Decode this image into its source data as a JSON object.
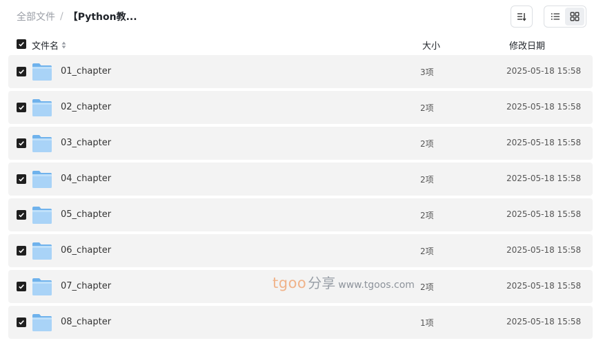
{
  "breadcrumb": {
    "root": "全部文件",
    "separator": "/",
    "current": "【Python教..."
  },
  "toolbar": {
    "sort_icon": "sort-list-icon",
    "list_view_icon": "list-view-icon",
    "grid_view_icon": "grid-view-icon",
    "active_view": "grid"
  },
  "table": {
    "headers": {
      "name": "文件名",
      "size": "大小",
      "date": "修改日期"
    },
    "select_all_checked": true,
    "rows": [
      {
        "name": "01_chapter",
        "size": "3项",
        "date": "2025-05-18 15:58",
        "checked": true
      },
      {
        "name": "02_chapter",
        "size": "2项",
        "date": "2025-05-18 15:58",
        "checked": true
      },
      {
        "name": "03_chapter",
        "size": "2项",
        "date": "2025-05-18 15:58",
        "checked": true
      },
      {
        "name": "04_chapter",
        "size": "2项",
        "date": "2025-05-18 15:58",
        "checked": true
      },
      {
        "name": "05_chapter",
        "size": "2项",
        "date": "2025-05-18 15:58",
        "checked": true
      },
      {
        "name": "06_chapter",
        "size": "2项",
        "date": "2025-05-18 15:58",
        "checked": true
      },
      {
        "name": "07_chapter",
        "size": "2项",
        "date": "2025-05-18 15:58",
        "checked": true
      },
      {
        "name": "08_chapter",
        "size": "1项",
        "date": "2025-05-18 15:58",
        "checked": true
      }
    ]
  },
  "watermark": {
    "brand": "tgoo",
    "cn": "分享",
    "url": "www.tgoos.com"
  },
  "colors": {
    "row_bg": "#f3f3f3",
    "folder_light": "#a9d3f7",
    "folder_dark": "#6fb2ec",
    "checkbox": "#1f1f1f"
  }
}
